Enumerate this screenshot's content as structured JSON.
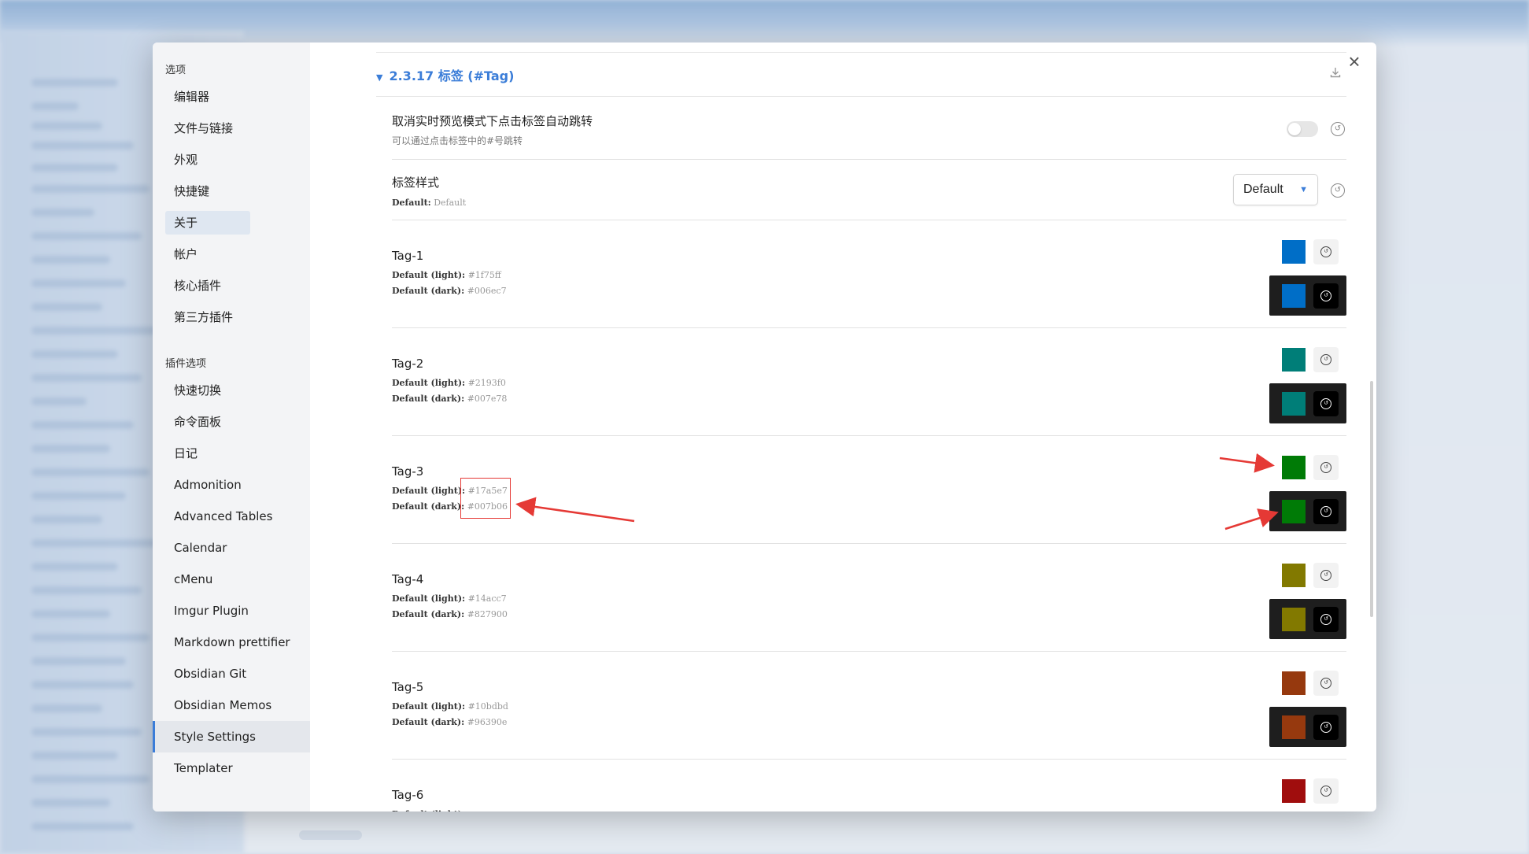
{
  "sidebar": {
    "group1_title": "选项",
    "items": [
      "编辑器",
      "文件与链接",
      "外观",
      "快捷键",
      "关于",
      "帐户",
      "核心插件",
      "第三方插件"
    ],
    "group2_title": "插件选项",
    "plugin_items": [
      "快速切换",
      "命令面板",
      "日记",
      "Admonition",
      "Advanced Tables",
      "Calendar",
      "cMenu",
      "Imgur Plugin",
      "Markdown prettifier",
      "Obsidian Git",
      "Obsidian Memos",
      "Style Settings",
      "Templater"
    ],
    "active_item": "Style Settings"
  },
  "section": {
    "caret": "▼",
    "title": "2.3.17 标签 (#Tag)",
    "download_icon": "download-icon"
  },
  "settings": {
    "tag_jump": {
      "name": "取消实时预览模式下点击标签自动跳转",
      "desc": "可以通过点击标签中的#号跳转",
      "enabled": false
    },
    "tag_style": {
      "name": "标签样式",
      "default_label": "Default:",
      "default_value": "Default",
      "select_value": "Default"
    }
  },
  "labels": {
    "light": "Default (light):",
    "dark": "Default (dark):"
  },
  "tags": [
    {
      "name": "Tag-1",
      "light": "#1f75ff",
      "dark": "#006ec7",
      "swatch_light": "#006ec7",
      "swatch_dark": "#006ec7"
    },
    {
      "name": "Tag-2",
      "light": "#2193f0",
      "dark": "#007e78",
      "swatch_light": "#007e78",
      "swatch_dark": "#007e78"
    },
    {
      "name": "Tag-3",
      "light": "#17a5e7",
      "dark": "#007b06",
      "swatch_light": "#007b06",
      "swatch_dark": "#007b06"
    },
    {
      "name": "Tag-4",
      "light": "#14acc7",
      "dark": "#827900",
      "swatch_light": "#827900",
      "swatch_dark": "#827900"
    },
    {
      "name": "Tag-5",
      "light": "#10bdbd",
      "dark": "#96390e",
      "swatch_light": "#96390e",
      "swatch_dark": "#96390e"
    },
    {
      "name": "Tag-6",
      "light": "",
      "dark": "",
      "swatch_light": "#a00d0d"
    }
  ],
  "colors": {
    "accent": "#3b7dd8",
    "annotation": "#e53935"
  },
  "close_icon": "×"
}
